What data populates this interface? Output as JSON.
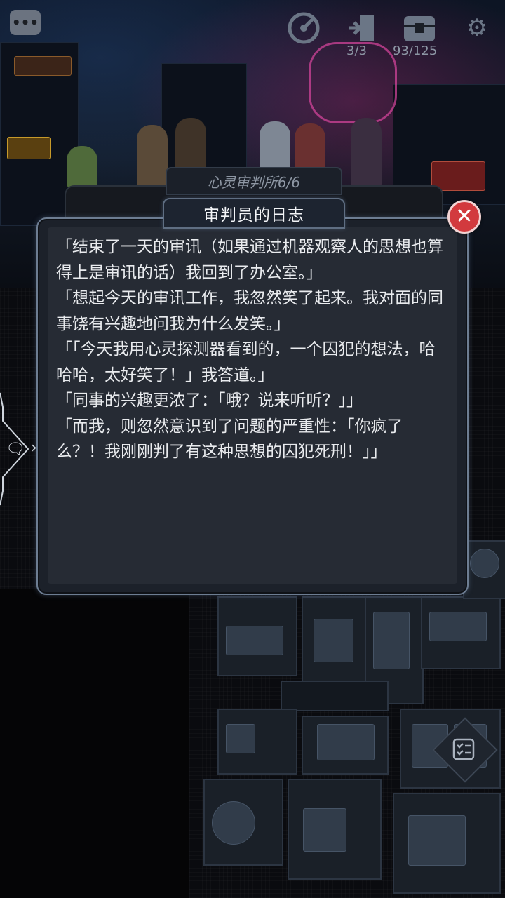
{
  "hud": {
    "chat_icon": "chat-bubble-icon",
    "timer_icon": "radar-icon",
    "door_icon": "door-exit-icon",
    "door_count": "3/3",
    "chest_icon": "chest-icon",
    "chest_count": "93/125",
    "settings_icon": "gear-icon"
  },
  "dialog": {
    "subtitle": "心灵审判所6/6",
    "title": "审判员的日志",
    "close_label": "✕",
    "paragraphs": [
      "「结束了一天的审讯（如果通过机器观察人的思想也算得上是审讯的话）我回到了办公室。」",
      "「想起今天的审讯工作，我忽然笑了起来。我对面的同事饶有兴趣地问我为什么发笑。」",
      "「「今天我用心灵探测器看到的，一个囚犯的想法，哈哈哈，太好笑了！」我答道。」",
      "「同事的兴趣更浓了：「哦？说来听听？」」",
      "「而我，则忽然意识到了问题的严重性：「你疯了么？！我刚刚判了有这种思想的囚犯死刑！」」"
    ]
  },
  "side_tab": {
    "icon": "chat-log-icon",
    "arrow": "›"
  },
  "quest": {
    "icon": "checklist-icon"
  }
}
